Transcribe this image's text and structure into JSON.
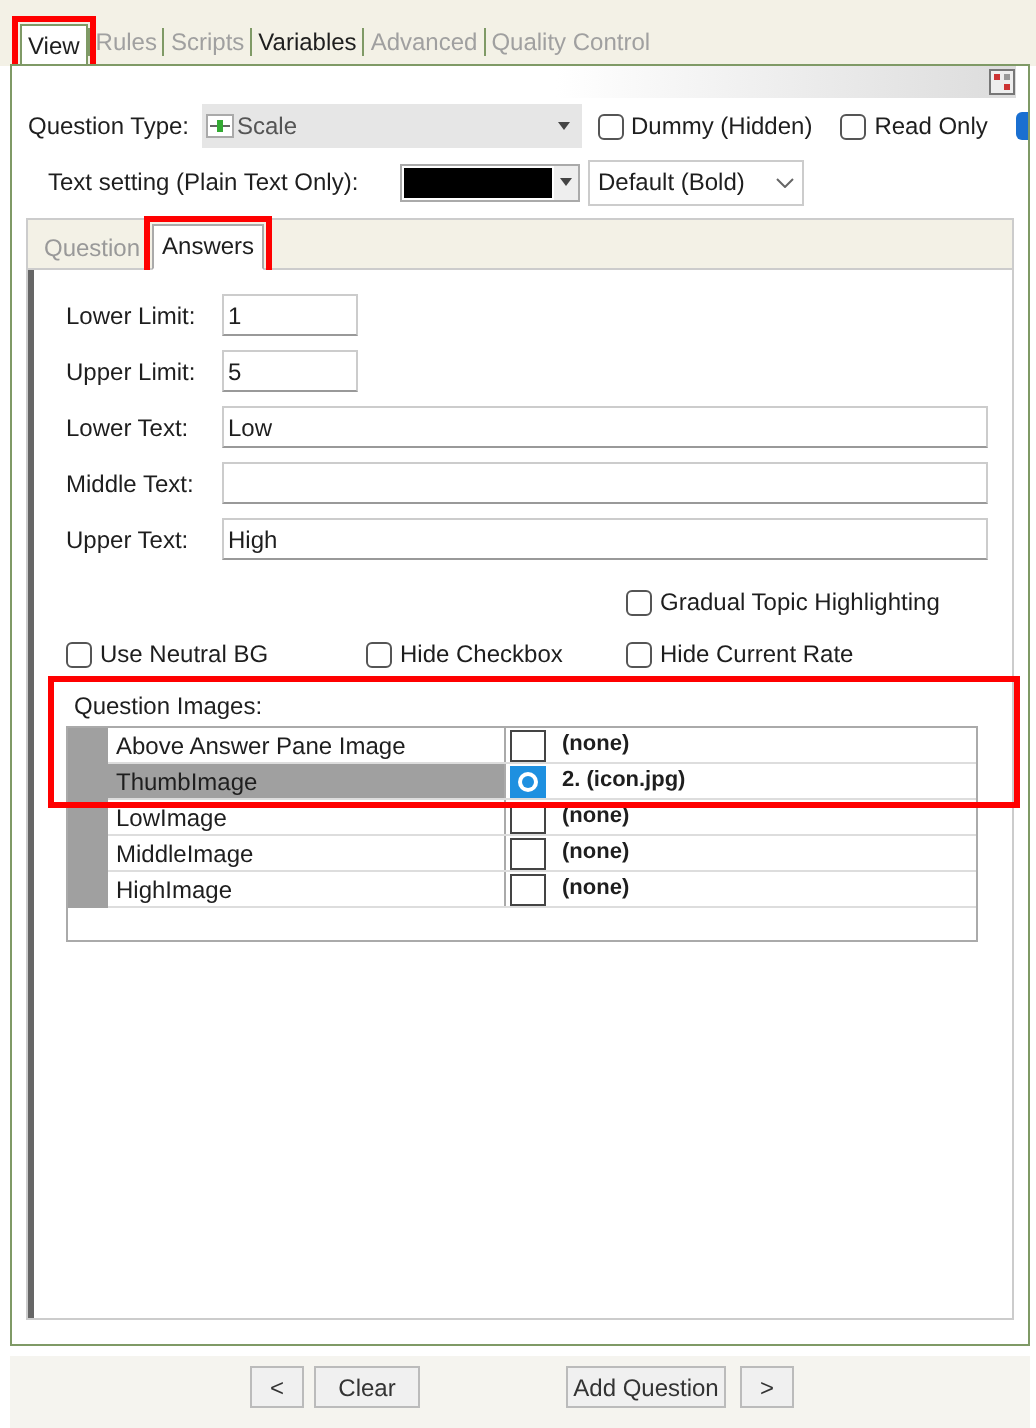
{
  "main_tabs": [
    {
      "label": "View",
      "selected": true,
      "disabled": false,
      "highlighted": true
    },
    {
      "label": "Rules",
      "selected": false,
      "disabled": true,
      "highlighted": false
    },
    {
      "label": "Scripts",
      "selected": false,
      "disabled": true,
      "highlighted": false
    },
    {
      "label": "Variables",
      "selected": false,
      "disabled": false,
      "highlighted": false
    },
    {
      "label": "Advanced",
      "selected": false,
      "disabled": true,
      "highlighted": false
    },
    {
      "label": "Quality Control",
      "selected": false,
      "disabled": true,
      "highlighted": false
    }
  ],
  "question_type": {
    "label": "Question Type:",
    "value": "Scale"
  },
  "options": [
    {
      "label": "Dummy (Hidden)",
      "checked": false
    },
    {
      "label": "Read Only",
      "checked": false
    }
  ],
  "text_setting": {
    "label": "Text setting (Plain Text Only):",
    "color": "#000000",
    "style": "Default (Bold)"
  },
  "inner_tabs": [
    {
      "label": "Question",
      "selected": false,
      "highlighted": false
    },
    {
      "label": "Answers",
      "selected": true,
      "highlighted": true
    }
  ],
  "fields": [
    {
      "label": "Lower Limit:",
      "value": "1",
      "kind": "short"
    },
    {
      "label": "Upper Limit:",
      "value": "5",
      "kind": "short"
    },
    {
      "label": "Lower Text:",
      "value": "Low",
      "kind": "wide"
    },
    {
      "label": "Middle Text:",
      "kind": "wide"
    },
    {
      "label": "Upper Text:",
      "value": "High",
      "kind": "wide"
    }
  ],
  "checkboxes": [
    {
      "label": "Gradual Topic Highlighting",
      "checked": false
    },
    {
      "label": "Use Neutral BG",
      "checked": false
    },
    {
      "label": "Hide Checkbox",
      "checked": false
    },
    {
      "label": "Hide Current Rate",
      "checked": false
    }
  ],
  "images": {
    "label": "Question Images:",
    "highlighted": true,
    "rows": [
      {
        "name": "Above Answer Pane Image",
        "value": "(none)",
        "selected": false,
        "thumbnail": false
      },
      {
        "name": "ThumbImage",
        "value": "2. (icon.jpg)",
        "selected": true,
        "thumbnail": true
      },
      {
        "name": "LowImage",
        "value": "(none)",
        "selected": false,
        "thumbnail": false
      },
      {
        "name": "MiddleImage",
        "value": "(none)",
        "selected": false,
        "thumbnail": false
      },
      {
        "name": "HighImage",
        "value": "(none)",
        "selected": false,
        "thumbnail": false
      }
    ]
  },
  "buttons": [
    {
      "label": "<"
    },
    {
      "label": "Clear"
    },
    {
      "label": "Add Question"
    },
    {
      "label": ">"
    }
  ]
}
